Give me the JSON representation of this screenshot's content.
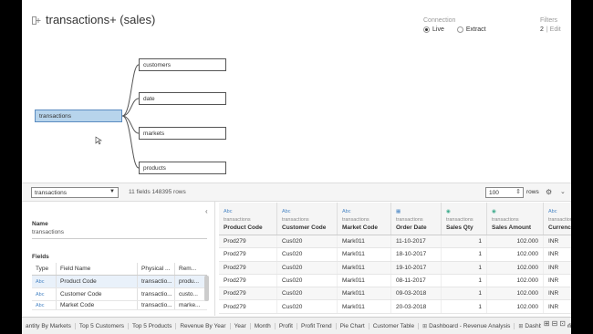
{
  "header": {
    "title": "transactions+ (sales)",
    "connection_label": "Connection",
    "live_label": "Live",
    "extract_label": "Extract",
    "connection_selected": "Live",
    "filters_label": "Filters",
    "filters_count": "2",
    "filters_edit": "| Edit"
  },
  "canvas": {
    "main_table": "transactions",
    "joined_tables": [
      "customers",
      "date",
      "markets",
      "products"
    ]
  },
  "bar": {
    "selected_table": "transactions",
    "fields_info": "11 fields 148395 rows",
    "rows_value": "100",
    "rows_label": "rows"
  },
  "metadata": {
    "name_label": "Name",
    "name_value": "transactions",
    "fields_label": "Fields",
    "columns": [
      "Type",
      "Field Name",
      "Physical ...",
      "Rem..."
    ],
    "rows": [
      {
        "type": "Abc",
        "name": "Product Code",
        "physical": "transactio...",
        "remote": "produ..."
      },
      {
        "type": "Abc",
        "name": "Customer Code",
        "physical": "transactio...",
        "remote": "custo..."
      },
      {
        "type": "Abc",
        "name": "Market Code",
        "physical": "transactio...",
        "remote": "marke..."
      }
    ]
  },
  "grid": {
    "columns": [
      {
        "icon": "Abc",
        "source": "transactions",
        "name": "Product Code"
      },
      {
        "icon": "Abc",
        "source": "transactions",
        "name": "Customer Code"
      },
      {
        "icon": "Abc",
        "source": "transactions",
        "name": "Market Code"
      },
      {
        "icon": "calendar",
        "source": "transactions",
        "name": "Order Date"
      },
      {
        "icon": "#",
        "source": "transactions",
        "name": "Sales Qty"
      },
      {
        "icon": "#",
        "source": "transactions",
        "name": "Sales Amount"
      },
      {
        "icon": "Abc",
        "source": "transactions",
        "name": "Currency"
      }
    ],
    "rows": [
      [
        "Prod279",
        "Cus020",
        "Mark011",
        "11-10-2017",
        "1",
        "102.000",
        "INR"
      ],
      [
        "Prod279",
        "Cus020",
        "Mark011",
        "18-10-2017",
        "1",
        "102.000",
        "INR"
      ],
      [
        "Prod279",
        "Cus020",
        "Mark011",
        "19-10-2017",
        "1",
        "102.000",
        "INR"
      ],
      [
        "Prod279",
        "Cus020",
        "Mark011",
        "08-11-2017",
        "1",
        "102.000",
        "INR"
      ],
      [
        "Prod279",
        "Cus020",
        "Mark011",
        "09-03-2018",
        "1",
        "102.000",
        "INR"
      ],
      [
        "Prod279",
        "Cus020",
        "Mark011",
        "20-03-2018",
        "1",
        "102.000",
        "INR"
      ]
    ]
  },
  "tabs": [
    {
      "label": "antity By Markets",
      "dashboard": false
    },
    {
      "label": "Top 5 Customers",
      "dashboard": false
    },
    {
      "label": "Top 5 Products",
      "dashboard": false
    },
    {
      "label": "Revenue By Year",
      "dashboard": false
    },
    {
      "label": "Year",
      "dashboard": false
    },
    {
      "label": "Month",
      "dashboard": false
    },
    {
      "label": "Profit",
      "dashboard": false
    },
    {
      "label": "Profit Trend",
      "dashboard": false
    },
    {
      "label": "Pie Chart",
      "dashboard": false
    },
    {
      "label": "Customer Table",
      "dashboard": false
    },
    {
      "label": "Dashboard - Revenue Analysis",
      "dashboard": true
    },
    {
      "label": "Dashboard - Profit Analysis",
      "dashboard": true
    }
  ],
  "colors": {
    "main_table_fill": "#b7d4ec",
    "type_icon": "#4a86c5",
    "numeric_icon": "#3aa98a"
  }
}
